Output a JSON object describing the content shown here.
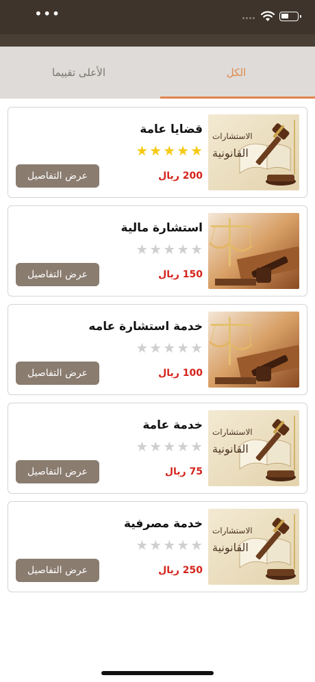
{
  "status_bar": {
    "menu_dots": "•••"
  },
  "tabs": [
    {
      "label": "الكل",
      "active": true
    },
    {
      "label": "الأعلى تقييما",
      "active": false
    }
  ],
  "details_label": "عرض التفاصيل",
  "thumb_text_line1": "الاستشارات",
  "thumb_text_line2": "القانونية",
  "services": [
    {
      "title": "قضايا عامة",
      "rating": 5,
      "price": "200 ريال",
      "image": "logo"
    },
    {
      "title": "استشارة مالية",
      "rating": 0,
      "price": "150 ريال",
      "image": "scales"
    },
    {
      "title": "خدمة استشارة عامه",
      "rating": 0,
      "price": "100 ريال",
      "image": "scales"
    },
    {
      "title": "خدمة عامة",
      "rating": 0,
      "price": "75 ريال",
      "image": "logo"
    },
    {
      "title": "خدمة مصرفية",
      "rating": 0,
      "price": "250 ريال",
      "image": "logo"
    }
  ],
  "colors": {
    "status_bar": "#3e342b",
    "tab_bar": "#dedbd8",
    "accent": "#e2824a",
    "price": "#d3231b",
    "button": "#8a7c6f",
    "star_on": "#f6c913",
    "star_off": "#cfcfcf"
  }
}
